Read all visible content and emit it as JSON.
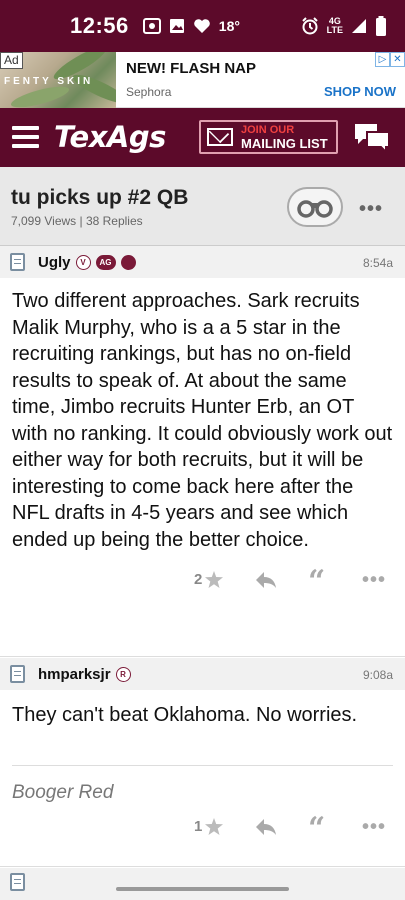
{
  "status_bar": {
    "time": "12:56",
    "temperature": "18°",
    "network_line1": "4G",
    "network_line2": "LTE",
    "background_color": "#5c0a2a"
  },
  "ad": {
    "tag": "Ad",
    "brand_text": "FENTY SKIN",
    "title": "NEW! FLASH NAP",
    "source": "Sephora",
    "cta": "SHOP NOW",
    "info_icon": "ad-info-icon",
    "close_icon": "ad-close-icon"
  },
  "header": {
    "logo": "TexAgs",
    "mailing_join": "JOIN OUR",
    "mailing_list": "MAILING LIST",
    "menu_icon": "hamburger-menu-icon",
    "chat_icon": "chat-bubbles-icon",
    "accent_color": "#5c0a2a"
  },
  "thread": {
    "title": "tu picks up #2 QB",
    "meta": "7,099 Views | 38 Replies",
    "watch_icon": "binoculars-icon",
    "more_icon": "more-dots-icon"
  },
  "posts": [
    {
      "user": "Ugly",
      "badges": [
        "V",
        "AG"
      ],
      "time": "8:54a",
      "body": "Two different approaches. Sark recruits Malik Murphy, who is a a 5 star in the recruiting rankings, but has no on-field results to speak of. At about the same time, Jimbo recruits Hunter Erb, an OT with no ranking. It could obviously work out either way for both recruits, but it will be interesting to come back here after the NFL drafts in 4-5 years and see which ended up being the better choice.",
      "signature": "",
      "rating": "2"
    },
    {
      "user": "hmparksjr",
      "badges": [
        "R"
      ],
      "time": "9:08a",
      "body": "They can't beat Oklahoma. No worries.",
      "signature": "Booger Red",
      "rating": "1"
    }
  ]
}
